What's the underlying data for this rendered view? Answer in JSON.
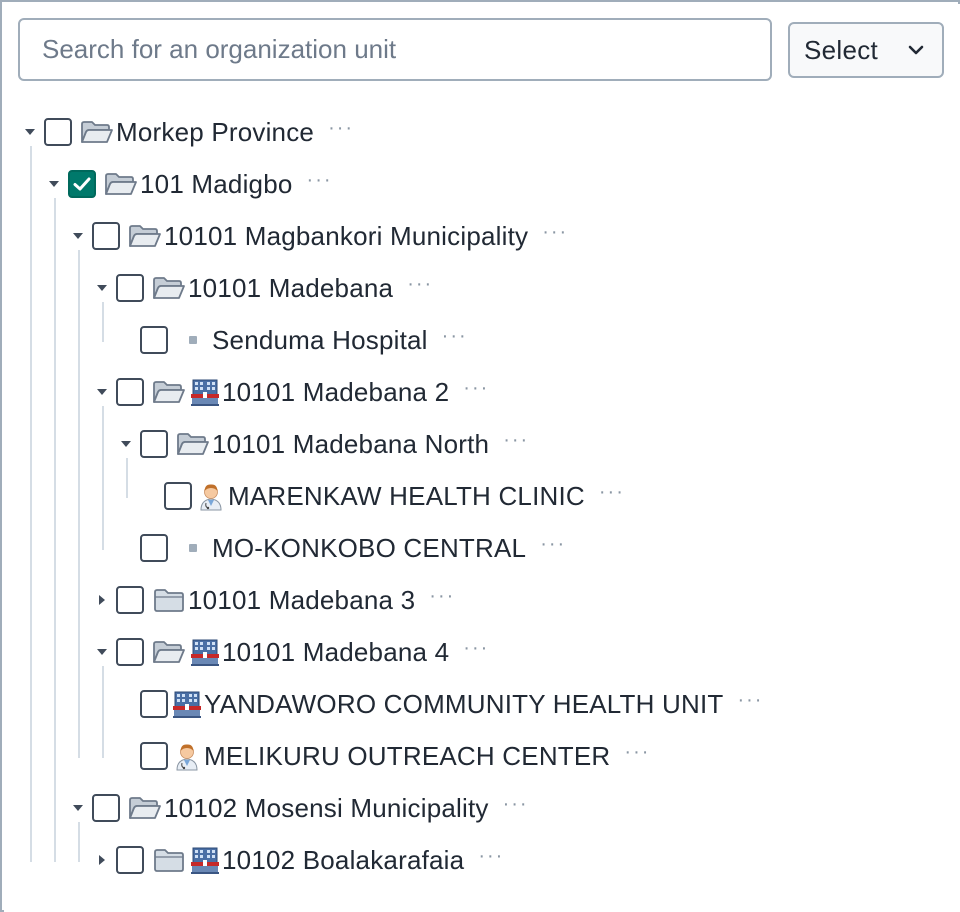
{
  "search": {
    "placeholder": "Search for an organization unit"
  },
  "select_button": {
    "label": "Select"
  },
  "more_label": "···",
  "tree": [
    {
      "id": "morkep",
      "label": "Morkep Province",
      "level": 0,
      "expanded": true,
      "checked": false,
      "icons": [
        "folder-open-icon"
      ]
    },
    {
      "id": "madigbo",
      "label": "101 Madigbo",
      "level": 1,
      "expanded": true,
      "checked": true,
      "icons": [
        "folder-open-icon"
      ]
    },
    {
      "id": "magbankori",
      "label": "10101 Magbankori Municipality",
      "level": 2,
      "expanded": true,
      "checked": false,
      "icons": [
        "folder-open-icon"
      ]
    },
    {
      "id": "madebana",
      "label": "10101 Madebana",
      "level": 3,
      "expanded": true,
      "checked": false,
      "icons": [
        "folder-open-icon"
      ]
    },
    {
      "id": "senduma",
      "label": "Senduma Hospital",
      "level": 4,
      "leaf": true,
      "checked": false,
      "icons": [
        "bullet-icon"
      ]
    },
    {
      "id": "madebana2",
      "label": "10101 Madebana 2",
      "level": 3,
      "expanded": true,
      "checked": false,
      "icons": [
        "folder-open-icon",
        "building-icon"
      ]
    },
    {
      "id": "madebana-north",
      "label": "10101 Madebana North",
      "level": 4,
      "expanded": true,
      "checked": false,
      "icons": [
        "folder-open-icon"
      ]
    },
    {
      "id": "marenkaw",
      "label": "MARENKAW HEALTH CLINIC",
      "level": 5,
      "leaf": true,
      "checked": false,
      "icons": [
        "doctor-icon"
      ]
    },
    {
      "id": "mokonkobo",
      "label": "MO-KONKOBO CENTRAL",
      "level": 4,
      "leaf": true,
      "checked": false,
      "icons": [
        "bullet-icon"
      ]
    },
    {
      "id": "madebana3",
      "label": "10101 Madebana 3",
      "level": 3,
      "expanded": false,
      "checked": false,
      "icons": [
        "folder-closed-icon"
      ]
    },
    {
      "id": "madebana4",
      "label": "10101 Madebana 4",
      "level": 3,
      "expanded": true,
      "checked": false,
      "icons": [
        "folder-open-icon",
        "building-icon"
      ]
    },
    {
      "id": "yandaworo",
      "label": "YANDAWORO COMMUNITY HEALTH UNIT",
      "level": 4,
      "leaf": true,
      "checked": false,
      "icons": [
        "building-icon"
      ]
    },
    {
      "id": "melikuru",
      "label": "MELIKURU OUTREACH CENTER",
      "level": 4,
      "leaf": true,
      "checked": false,
      "icons": [
        "doctor-icon"
      ]
    },
    {
      "id": "mosensi",
      "label": "10102 Mosensi Municipality",
      "level": 2,
      "expanded": true,
      "checked": false,
      "icons": [
        "folder-open-icon"
      ]
    },
    {
      "id": "boalakarafaia",
      "label": "10102 Boalakarafaia",
      "level": 3,
      "expanded": false,
      "checked": false,
      "icons": [
        "folder-closed-icon",
        "building-icon"
      ]
    }
  ],
  "colors": {
    "checkbox_checked": "#00796b",
    "border": "#a0adba",
    "guide_line": "#d5dde5",
    "text": "#212934"
  }
}
